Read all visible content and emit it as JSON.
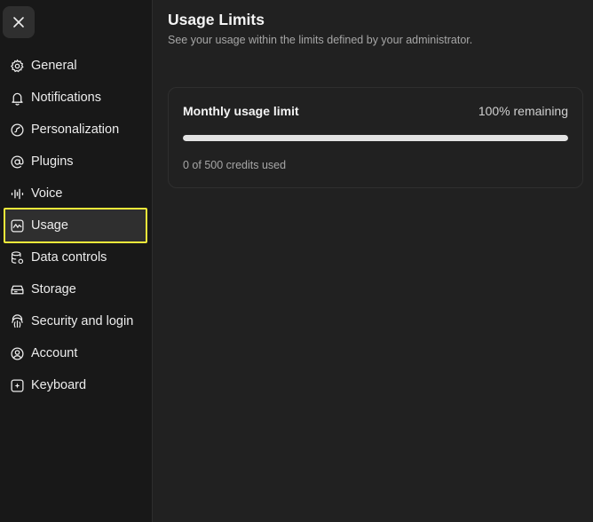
{
  "window": {
    "close_icon": "close-icon"
  },
  "sidebar": {
    "items": [
      {
        "id": "general",
        "label": "General",
        "icon": "gear-icon"
      },
      {
        "id": "notifications",
        "label": "Notifications",
        "icon": "bell-icon"
      },
      {
        "id": "personalization",
        "label": "Personalization",
        "icon": "personalization-icon"
      },
      {
        "id": "plugins",
        "label": "Plugins",
        "icon": "at-sign-icon"
      },
      {
        "id": "voice",
        "label": "Voice",
        "icon": "waveform-icon"
      },
      {
        "id": "usage",
        "label": "Usage",
        "icon": "chart-icon",
        "active": true
      },
      {
        "id": "data-controls",
        "label": "Data controls",
        "icon": "database-gear-icon"
      },
      {
        "id": "storage",
        "label": "Storage",
        "icon": "hard-drive-icon"
      },
      {
        "id": "security",
        "label": "Security and login",
        "icon": "fingerprint-icon"
      },
      {
        "id": "account",
        "label": "Account",
        "icon": "user-circle-icon"
      },
      {
        "id": "keyboard",
        "label": "Keyboard",
        "icon": "keyboard-icon"
      }
    ]
  },
  "main": {
    "title": "Usage Limits",
    "subtitle": "See your usage within the limits defined by your administrator.",
    "card": {
      "title": "Monthly usage limit",
      "remaining": "100% remaining",
      "remaining_fraction": 1.0,
      "used_text": "0 of 500 credits used"
    }
  },
  "colors": {
    "highlight": "#f2ea3a",
    "sidebar_bg": "#181818",
    "main_bg": "#212121",
    "bar_fill": "#e3e3e3"
  }
}
